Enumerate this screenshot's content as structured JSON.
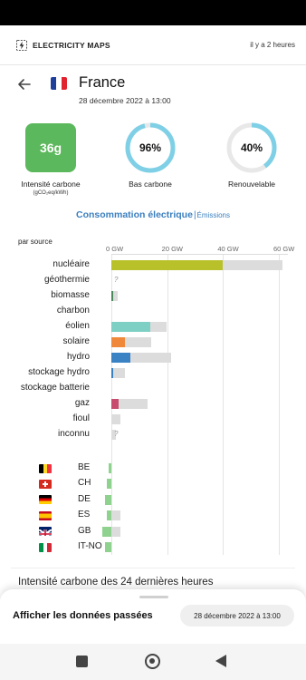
{
  "app": {
    "brand": "ELECTRICITY MAPS",
    "updated": "il y a 2 heures"
  },
  "zone": {
    "name": "France",
    "datetime": "28 décembre 2022 à 13:00"
  },
  "metrics": {
    "carbon_intensity": {
      "value": "36g",
      "label": "Intensité carbone",
      "unit": "(gCO₂eq/kWh)",
      "color": "#5cb85c"
    },
    "low_carbon": {
      "value": "96%",
      "label": "Bas carbone",
      "fraction": 0.96
    },
    "renewable": {
      "value": "40%",
      "label": "Renouvelable",
      "fraction": 0.4
    }
  },
  "tabs": {
    "consumption": "Consommation électrique",
    "separator": "|",
    "emissions": "Émissions"
  },
  "chart_data": {
    "type": "bar",
    "title": "par source",
    "unit": "GW",
    "xlim": [
      0,
      60
    ],
    "ticks": [
      "0 GW",
      "20 GW",
      "40 GW",
      "60 GW"
    ],
    "tick_values": [
      0,
      20,
      40,
      60
    ],
    "series": [
      {
        "category": "nucléaire",
        "production": 40,
        "capacity": 61.4,
        "color": "#b8c02a"
      },
      {
        "category": "géothermie",
        "production": null,
        "capacity": null,
        "unknown": "?"
      },
      {
        "category": "biomasse",
        "production": 0.8,
        "capacity": 2.2,
        "color": "#4a8a5c"
      },
      {
        "category": "charbon",
        "production": 0,
        "capacity": 0
      },
      {
        "category": "éolien",
        "production": 13.8,
        "capacity": 19.8,
        "color": "#7ecfc4"
      },
      {
        "category": "solaire",
        "production": 4.9,
        "capacity": 14.2,
        "color": "#f0883b"
      },
      {
        "category": "hydro",
        "production": 6.9,
        "capacity": 21.3,
        "color": "#3a82c4"
      },
      {
        "category": "stockage hydro",
        "production": 0.6,
        "capacity": 5.0,
        "color": "#3a82c4"
      },
      {
        "category": "stockage batterie",
        "production": 0,
        "capacity": 0
      },
      {
        "category": "gaz",
        "production": 2.5,
        "capacity": 13.1,
        "color": "#c84c6e"
      },
      {
        "category": "fioul",
        "production": 0,
        "capacity": 3.2
      },
      {
        "category": "inconnu",
        "production": null,
        "capacity": 1.6,
        "unknown": "?"
      }
    ],
    "exchanges": [
      {
        "code": "BE",
        "value": -1.1,
        "capacity": -1.1,
        "color": "#8fd18f"
      },
      {
        "code": "CH",
        "value": -1.7,
        "capacity": -1.7,
        "color": "#8fd18f"
      },
      {
        "code": "DE",
        "value": -2.3,
        "capacity": -2.3,
        "color": "#8fd18f"
      },
      {
        "code": "ES",
        "value": -1.5,
        "capacity": 3.3,
        "color": "#8fd18f"
      },
      {
        "code": "GB",
        "value": -3.1,
        "capacity": 3.1,
        "color": "#8fd18f"
      },
      {
        "code": "IT-NO",
        "value": -2.3,
        "capacity": -2.3,
        "color": "#8fd18f"
      }
    ]
  },
  "history": {
    "title": "Intensité carbone des 24 dernières heures"
  },
  "sheet": {
    "title": "Afficher les données passées",
    "date": "28 décembre 2022 à 13:00"
  },
  "colors": {
    "accent": "#3b7fbf",
    "ring": "#7fd0e6",
    "ring_track": "#e8e8e8",
    "capacity": "#dcdcdc"
  }
}
